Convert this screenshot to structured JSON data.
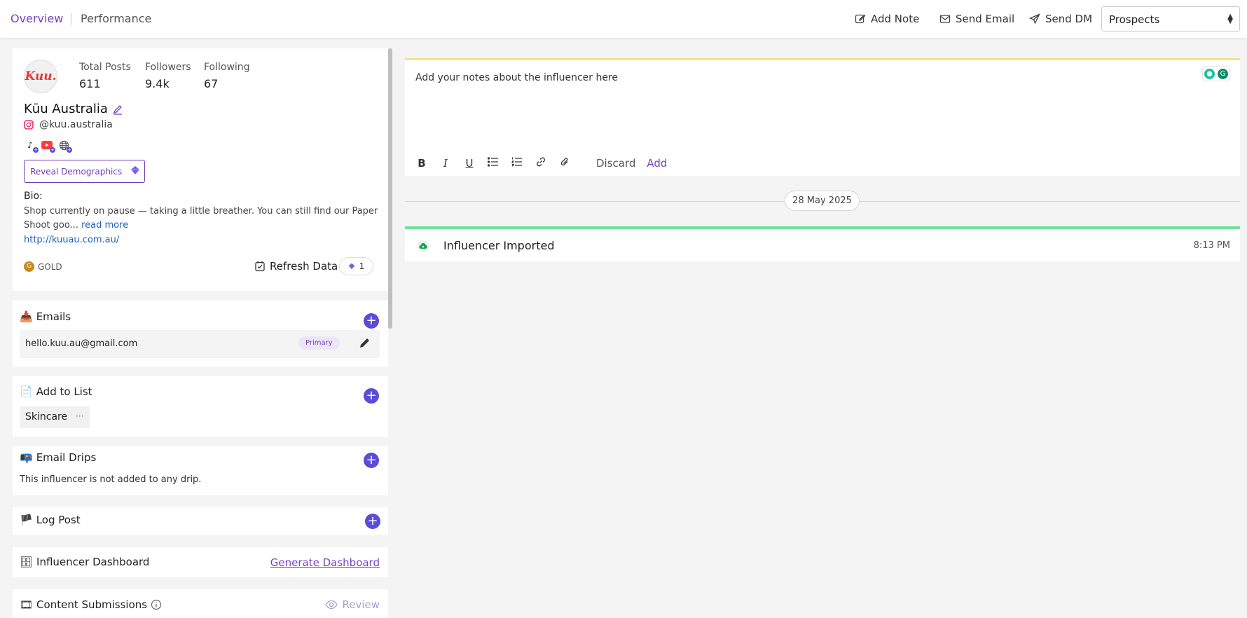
{
  "tabs": {
    "overview": "Overview",
    "performance": "Performance"
  },
  "actions": {
    "add_note": "Add Note",
    "send_email": "Send Email",
    "send_dm": "Send DM"
  },
  "status_select": {
    "value": "Prospects"
  },
  "profile": {
    "avatar_text": "Kuu.",
    "stats": [
      {
        "label": "Total Posts",
        "value": "611"
      },
      {
        "label": "Followers",
        "value": "9.4k"
      },
      {
        "label": "Following",
        "value": "67"
      }
    ],
    "name": "Kūu Australia",
    "handle": "@kuu.australia",
    "social_icons": [
      "tiktok-icon",
      "youtube-icon",
      "website-icon"
    ],
    "reveal_label": "Reveal Demographics",
    "bio_label": "Bio:",
    "bio_text": "Shop currently on pause — taking a little breather. You can still find our Paper Shoot goo...",
    "read_more": "read more",
    "website": "http://kuuau.com.au/",
    "tier": "GOLD",
    "refresh_label": "Refresh Data",
    "credits": "1"
  },
  "emails": {
    "title": "Emails",
    "items": [
      {
        "address": "hello.kuu.au@gmail.com",
        "badge": "Primary"
      }
    ]
  },
  "add_to_list": {
    "title": "Add to List",
    "chips": [
      "Skincare"
    ]
  },
  "email_drips": {
    "title": "Email Drips",
    "empty_text": "This influencer is not added to any drip."
  },
  "log_post": {
    "title": "Log Post"
  },
  "influencer_dashboard": {
    "title": "Influencer Dashboard",
    "link": "Generate Dashboard"
  },
  "content_submissions": {
    "title": "Content Submissions",
    "review": "Review"
  },
  "notes": {
    "placeholder": "Add your notes about the influencer here",
    "discard": "Discard",
    "add": "Add"
  },
  "timeline": {
    "date": "28 May 2025",
    "events": [
      {
        "title": "Influencer Imported",
        "time": "8:13 PM"
      }
    ]
  },
  "colors": {
    "accent": "#7b3fc4",
    "plus_button": "#5b4bd6",
    "link": "#1f5fbf",
    "activity_border": "#6fe39a",
    "editor_border": "#f3e28b"
  }
}
